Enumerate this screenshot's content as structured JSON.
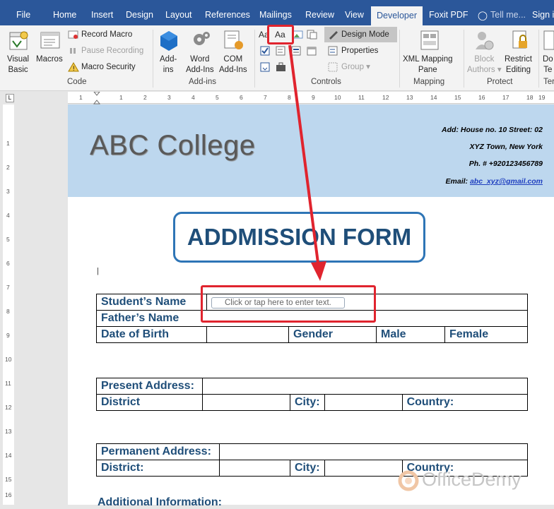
{
  "tabs": [
    "File",
    "Home",
    "Insert",
    "Design",
    "Layout",
    "References",
    "Mailings",
    "Review",
    "View",
    "Developer",
    "Foxit PDF",
    "Tell me...",
    "Sign in"
  ],
  "ribbon": {
    "code": {
      "visual_basic": [
        "Visual",
        "Basic"
      ],
      "macros": "Macros",
      "record_macro": "Record Macro",
      "pause_recording": "Pause Recording",
      "macro_security": "Macro Security",
      "group": "Code"
    },
    "addins": {
      "addins": [
        "Add-",
        "ins"
      ],
      "word_addins": [
        "Word",
        "Add-Ins"
      ],
      "com_addins": [
        "COM",
        "Add-Ins"
      ],
      "group": "Add-ins"
    },
    "controls": {
      "aa_plain": "Aa",
      "aa_rich": "Aa",
      "design_mode": "Design Mode",
      "properties": "Properties",
      "group_btn": "Group",
      "group": "Controls"
    },
    "mapping": {
      "xml_mapping": [
        "XML Mapping",
        "Pane"
      ],
      "group": "Mapping"
    },
    "protect": {
      "block_authors": [
        "Block",
        "Authors"
      ],
      "restrict_editing": [
        "Restrict",
        "Editing"
      ],
      "group": "Protect"
    },
    "templates": {
      "label": [
        "Do",
        "Te"
      ],
      "group": "Ter"
    }
  },
  "ruler": {
    "h": [
      "1",
      "1",
      "2",
      "3",
      "4",
      "5",
      "6",
      "7",
      "8",
      "9",
      "10",
      "11",
      "12",
      "13",
      "14",
      "15",
      "16",
      "17",
      "18",
      "19"
    ],
    "v": [
      "1",
      "2",
      "3",
      "4",
      "5",
      "6",
      "7",
      "8",
      "9",
      "10",
      "11",
      "12",
      "13",
      "14",
      "15",
      "16"
    ]
  },
  "document": {
    "college": "ABC College",
    "address": [
      "Add: House no. 10 Street: 02",
      "XYZ Town, New York",
      "Ph. # +920123456789"
    ],
    "email_label": "Email:",
    "email": "abc_xyz@gmail.com",
    "form_title": "ADDMISSION FORM",
    "student_name": "Student’s Name",
    "placeholder": "Click or tap here to enter text.",
    "father_name": "Father’s Name",
    "dob": "Date of Birth",
    "gender": "Gender",
    "male": "Male",
    "female": "Female",
    "present_address": "Present Address:",
    "district1": "District",
    "city": "City:",
    "country": "Country:",
    "permanent_address": "Permanent Address:",
    "district2": "District:",
    "additional": "Additional Information:"
  },
  "watermark": "OfficeDemy",
  "colors": {
    "ribbon_blue": "#2b579a",
    "header_band": "#bdd7ee",
    "form_blue": "#1f4e79",
    "annotation_red": "#e0242e"
  }
}
